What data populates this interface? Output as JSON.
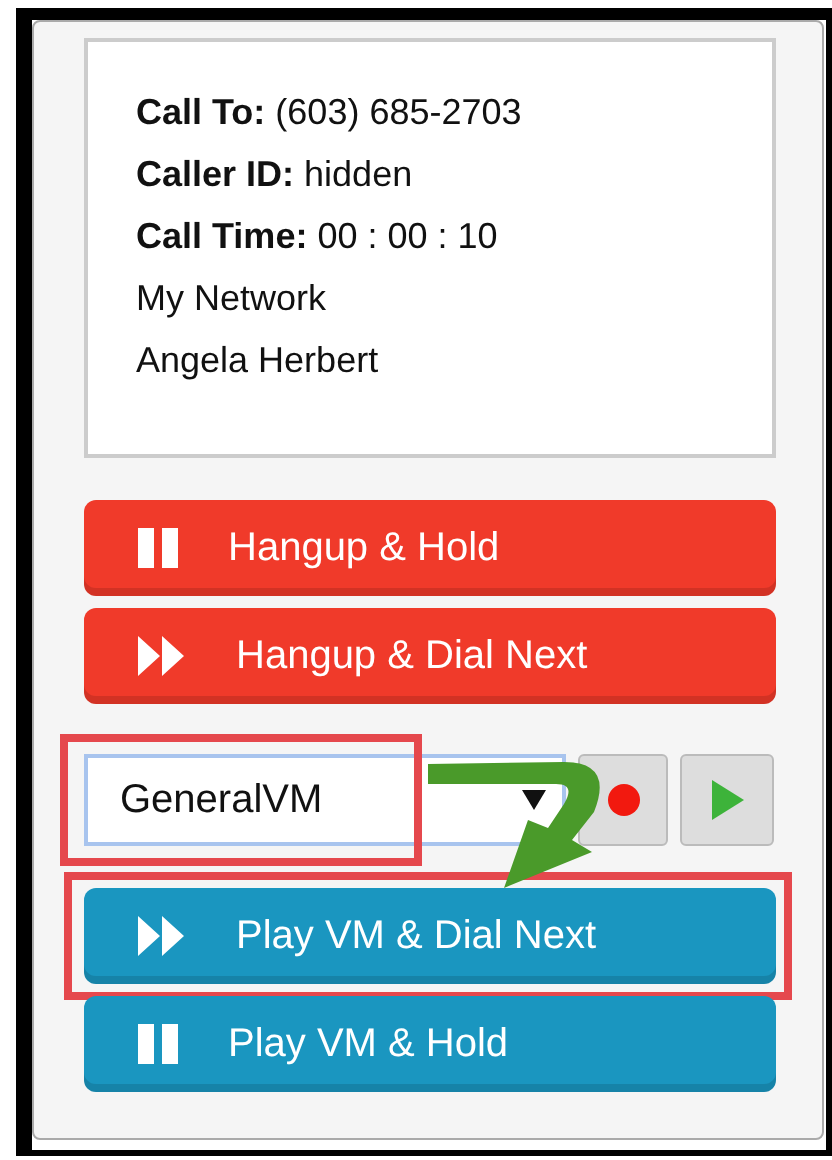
{
  "info_lines": [
    "**Call To:** (603) 685-2703",
    "**Caller ID:** hidden",
    "**Call Time:** 00 : 00 : 10",
    "My Network",
    "Angela Herbert"
  ],
  "hangup_buttons": [
    {
      "label": "Hangup & Hold",
      "kind": "pause",
      "color": "#f03a2a"
    },
    {
      "label": "Hangup & Dial Next",
      "kind": "forward",
      "color": "#f03a2a"
    }
  ],
  "voicemail_select": {
    "value": "GeneralVM",
    "highlighted": true
  },
  "vm_buttons": [
    {
      "label": "Play VM & Dial Next",
      "kind": "forward",
      "color": "#1a96c0",
      "highlighted": true
    },
    {
      "label": "Play VM & Hold",
      "kind": "pause",
      "color": "#1a96c0",
      "highlighted": false
    }
  ]
}
